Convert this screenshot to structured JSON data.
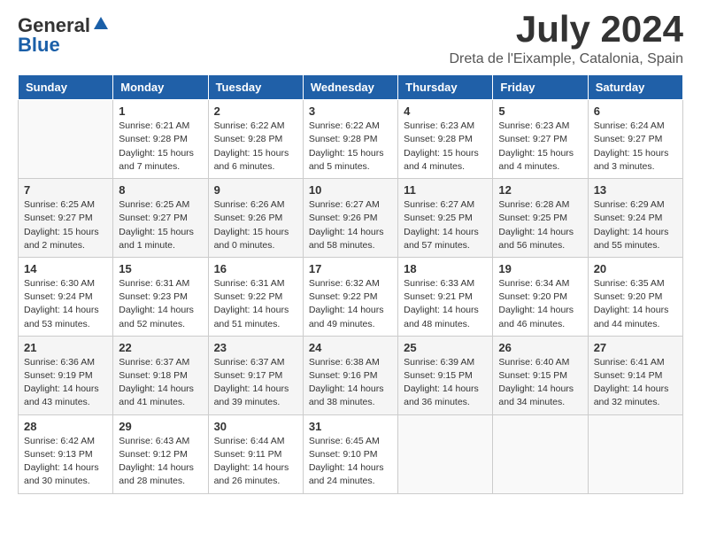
{
  "logo": {
    "general": "General",
    "blue": "Blue"
  },
  "title": {
    "month_year": "July 2024",
    "location": "Dreta de l'Eixample, Catalonia, Spain"
  },
  "headers": [
    "Sunday",
    "Monday",
    "Tuesday",
    "Wednesday",
    "Thursday",
    "Friday",
    "Saturday"
  ],
  "weeks": [
    [
      {
        "day": "",
        "sunrise": "",
        "sunset": "",
        "daylight": ""
      },
      {
        "day": "1",
        "sunrise": "Sunrise: 6:21 AM",
        "sunset": "Sunset: 9:28 PM",
        "daylight": "Daylight: 15 hours and 7 minutes."
      },
      {
        "day": "2",
        "sunrise": "Sunrise: 6:22 AM",
        "sunset": "Sunset: 9:28 PM",
        "daylight": "Daylight: 15 hours and 6 minutes."
      },
      {
        "day": "3",
        "sunrise": "Sunrise: 6:22 AM",
        "sunset": "Sunset: 9:28 PM",
        "daylight": "Daylight: 15 hours and 5 minutes."
      },
      {
        "day": "4",
        "sunrise": "Sunrise: 6:23 AM",
        "sunset": "Sunset: 9:28 PM",
        "daylight": "Daylight: 15 hours and 4 minutes."
      },
      {
        "day": "5",
        "sunrise": "Sunrise: 6:23 AM",
        "sunset": "Sunset: 9:27 PM",
        "daylight": "Daylight: 15 hours and 4 minutes."
      },
      {
        "day": "6",
        "sunrise": "Sunrise: 6:24 AM",
        "sunset": "Sunset: 9:27 PM",
        "daylight": "Daylight: 15 hours and 3 minutes."
      }
    ],
    [
      {
        "day": "7",
        "sunrise": "Sunrise: 6:25 AM",
        "sunset": "Sunset: 9:27 PM",
        "daylight": "Daylight: 15 hours and 2 minutes."
      },
      {
        "day": "8",
        "sunrise": "Sunrise: 6:25 AM",
        "sunset": "Sunset: 9:27 PM",
        "daylight": "Daylight: 15 hours and 1 minute."
      },
      {
        "day": "9",
        "sunrise": "Sunrise: 6:26 AM",
        "sunset": "Sunset: 9:26 PM",
        "daylight": "Daylight: 15 hours and 0 minutes."
      },
      {
        "day": "10",
        "sunrise": "Sunrise: 6:27 AM",
        "sunset": "Sunset: 9:26 PM",
        "daylight": "Daylight: 14 hours and 58 minutes."
      },
      {
        "day": "11",
        "sunrise": "Sunrise: 6:27 AM",
        "sunset": "Sunset: 9:25 PM",
        "daylight": "Daylight: 14 hours and 57 minutes."
      },
      {
        "day": "12",
        "sunrise": "Sunrise: 6:28 AM",
        "sunset": "Sunset: 9:25 PM",
        "daylight": "Daylight: 14 hours and 56 minutes."
      },
      {
        "day": "13",
        "sunrise": "Sunrise: 6:29 AM",
        "sunset": "Sunset: 9:24 PM",
        "daylight": "Daylight: 14 hours and 55 minutes."
      }
    ],
    [
      {
        "day": "14",
        "sunrise": "Sunrise: 6:30 AM",
        "sunset": "Sunset: 9:24 PM",
        "daylight": "Daylight: 14 hours and 53 minutes."
      },
      {
        "day": "15",
        "sunrise": "Sunrise: 6:31 AM",
        "sunset": "Sunset: 9:23 PM",
        "daylight": "Daylight: 14 hours and 52 minutes."
      },
      {
        "day": "16",
        "sunrise": "Sunrise: 6:31 AM",
        "sunset": "Sunset: 9:22 PM",
        "daylight": "Daylight: 14 hours and 51 minutes."
      },
      {
        "day": "17",
        "sunrise": "Sunrise: 6:32 AM",
        "sunset": "Sunset: 9:22 PM",
        "daylight": "Daylight: 14 hours and 49 minutes."
      },
      {
        "day": "18",
        "sunrise": "Sunrise: 6:33 AM",
        "sunset": "Sunset: 9:21 PM",
        "daylight": "Daylight: 14 hours and 48 minutes."
      },
      {
        "day": "19",
        "sunrise": "Sunrise: 6:34 AM",
        "sunset": "Sunset: 9:20 PM",
        "daylight": "Daylight: 14 hours and 46 minutes."
      },
      {
        "day": "20",
        "sunrise": "Sunrise: 6:35 AM",
        "sunset": "Sunset: 9:20 PM",
        "daylight": "Daylight: 14 hours and 44 minutes."
      }
    ],
    [
      {
        "day": "21",
        "sunrise": "Sunrise: 6:36 AM",
        "sunset": "Sunset: 9:19 PM",
        "daylight": "Daylight: 14 hours and 43 minutes."
      },
      {
        "day": "22",
        "sunrise": "Sunrise: 6:37 AM",
        "sunset": "Sunset: 9:18 PM",
        "daylight": "Daylight: 14 hours and 41 minutes."
      },
      {
        "day": "23",
        "sunrise": "Sunrise: 6:37 AM",
        "sunset": "Sunset: 9:17 PM",
        "daylight": "Daylight: 14 hours and 39 minutes."
      },
      {
        "day": "24",
        "sunrise": "Sunrise: 6:38 AM",
        "sunset": "Sunset: 9:16 PM",
        "daylight": "Daylight: 14 hours and 38 minutes."
      },
      {
        "day": "25",
        "sunrise": "Sunrise: 6:39 AM",
        "sunset": "Sunset: 9:15 PM",
        "daylight": "Daylight: 14 hours and 36 minutes."
      },
      {
        "day": "26",
        "sunrise": "Sunrise: 6:40 AM",
        "sunset": "Sunset: 9:15 PM",
        "daylight": "Daylight: 14 hours and 34 minutes."
      },
      {
        "day": "27",
        "sunrise": "Sunrise: 6:41 AM",
        "sunset": "Sunset: 9:14 PM",
        "daylight": "Daylight: 14 hours and 32 minutes."
      }
    ],
    [
      {
        "day": "28",
        "sunrise": "Sunrise: 6:42 AM",
        "sunset": "Sunset: 9:13 PM",
        "daylight": "Daylight: 14 hours and 30 minutes."
      },
      {
        "day": "29",
        "sunrise": "Sunrise: 6:43 AM",
        "sunset": "Sunset: 9:12 PM",
        "daylight": "Daylight: 14 hours and 28 minutes."
      },
      {
        "day": "30",
        "sunrise": "Sunrise: 6:44 AM",
        "sunset": "Sunset: 9:11 PM",
        "daylight": "Daylight: 14 hours and 26 minutes."
      },
      {
        "day": "31",
        "sunrise": "Sunrise: 6:45 AM",
        "sunset": "Sunset: 9:10 PM",
        "daylight": "Daylight: 14 hours and 24 minutes."
      },
      {
        "day": "",
        "sunrise": "",
        "sunset": "",
        "daylight": ""
      },
      {
        "day": "",
        "sunrise": "",
        "sunset": "",
        "daylight": ""
      },
      {
        "day": "",
        "sunrise": "",
        "sunset": "",
        "daylight": ""
      }
    ]
  ]
}
